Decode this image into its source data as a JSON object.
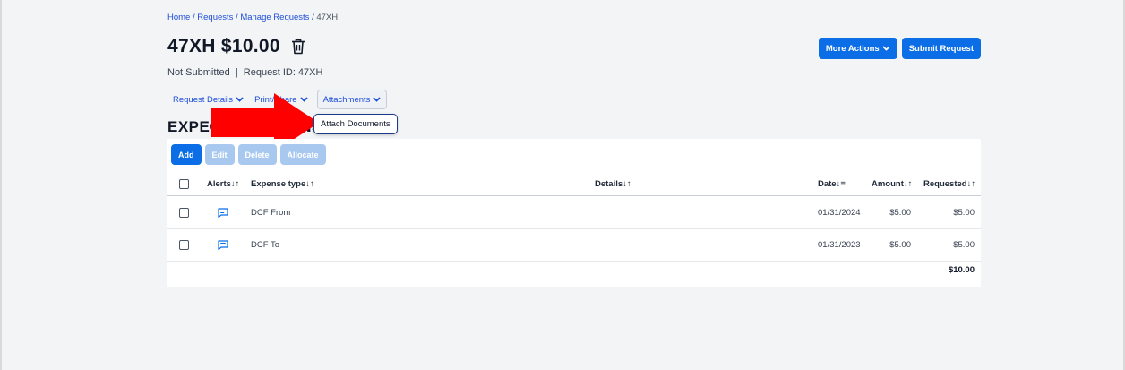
{
  "breadcrumb": {
    "home": "Home",
    "sep1": " / ",
    "requests": "Requests",
    "sep2": " / ",
    "manage": "Manage Requests",
    "sep3": " / ",
    "current": "47XH"
  },
  "header": {
    "title": "47XH $10.00",
    "status": "Not Submitted",
    "divider": "  |  ",
    "request_id": "Request ID: 47XH"
  },
  "toolbar": {
    "more_actions": "More Actions",
    "submit": "Submit Request"
  },
  "tabs": [
    {
      "label": "Request Details"
    },
    {
      "label": "Print/Share"
    },
    {
      "label": "Attachments"
    }
  ],
  "attachments_menu": {
    "attach_documents": "Attach Documents"
  },
  "section": {
    "title": "EXPECTED EXPENSES"
  },
  "actions": {
    "add": "Add",
    "edit": "Edit",
    "delete": "Delete",
    "allocate": "Allocate"
  },
  "table": {
    "headers": {
      "alerts": "Alerts↓↑",
      "expense_type": "Expense type↓↑",
      "details": "Details↓↑",
      "date": "Date↓≡",
      "amount": "Amount↓↑",
      "requested": "Requested↓↑"
    },
    "rows": [
      {
        "type": "DCF From",
        "details": "",
        "date": "01/31/2024",
        "amount": "$5.00",
        "requested": "$5.00"
      },
      {
        "type": "DCF To",
        "details": "",
        "date": "01/31/2023",
        "amount": "$5.00",
        "requested": "$5.00"
      }
    ],
    "total": "$10.00"
  },
  "colors": {
    "primary": "#0b6ee6",
    "disabled": "#a8c8ef",
    "annotation_arrow": "#ff0000"
  }
}
